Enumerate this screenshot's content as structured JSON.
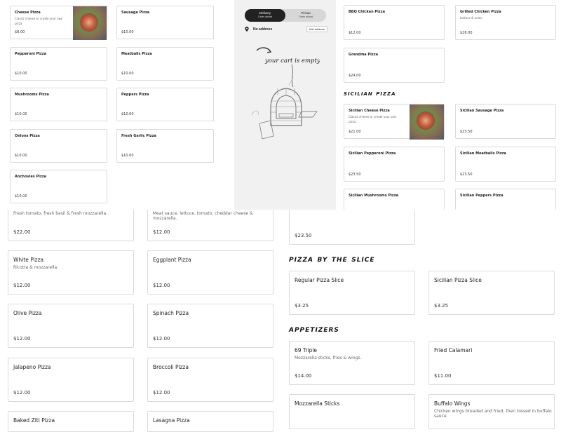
{
  "left_column_small": [
    {
      "name": "Cheese Pizza",
      "desc": "Classic cheese or create your own pizza.",
      "price": "$8.00",
      "thumb": true
    },
    {
      "name": "Pepperoni Pizza",
      "price": "$10.00"
    },
    {
      "name": "Mushrooms Pizza",
      "price": "$10.00"
    },
    {
      "name": "Onions Pizza",
      "price": "$10.00"
    },
    {
      "name": "Anchovies Pizza",
      "price": "$10.00"
    }
  ],
  "middle_column_small": [
    {
      "name": "Sausage Pizza",
      "price": "$10.00"
    },
    {
      "name": "Meatballs Pizza",
      "price": "$10.00"
    },
    {
      "name": "Peppers Pizza",
      "price": "$10.00"
    },
    {
      "name": "Fresh Garlic Pizza",
      "price": "$10.00"
    }
  ],
  "right_top": [
    {
      "name": "BBQ Chicken Pizza",
      "price": "$12.00"
    },
    {
      "name": "Grilled Chicken Pizza",
      "desc": "Lettuce & onion.",
      "price": "$26.00"
    },
    {
      "name": "Grandma Pizza",
      "price": "$24.00"
    }
  ],
  "sicilian_section_title": "sicilian pizza",
  "sicilian_items": [
    {
      "name": "Sicilian Cheese Pizza",
      "desc": "Classic cheese or create your own pizza.",
      "price": "$21.00",
      "thumb": true
    },
    {
      "name": "Sicilian Sausage Pizza",
      "price": "$23.50"
    },
    {
      "name": "Sicilian Pepperoni Pizza",
      "price": "$23.50"
    },
    {
      "name": "Sicilian Meatballs Pizza",
      "price": "$23.50"
    },
    {
      "name": "Sicilian Mushrooms Pizza",
      "price": ""
    },
    {
      "name": "Sicilian Peppers Pizza",
      "price": ""
    }
  ],
  "cart": {
    "delivery_label": "Delivery",
    "delivery_sub": "Order ahead",
    "pickup_label": "Pickup",
    "pickup_sub": "Order ahead",
    "address_label": "No address",
    "add_address_button": "Add address",
    "empty_text": "your cart is empty"
  },
  "bottom_left": [
    {
      "name": "",
      "desc": "Fresh tomato, fresh basil & fresh mozzarella.",
      "price": "$22.00"
    },
    {
      "name": "White Pizza",
      "desc": "Ricotta & mozzarella.",
      "price": "$12.00"
    },
    {
      "name": "Olive Pizza",
      "price": "$12.00"
    },
    {
      "name": "Jalapeno Pizza",
      "price": "$12.00"
    },
    {
      "name": "Baked Ziti Pizza",
      "price": ""
    }
  ],
  "bottom_middle": [
    {
      "name": "",
      "desc": "Meat sauce, lettuce, tomato, cheddar cheese & mozzarella.",
      "price": "$12.00"
    },
    {
      "name": "Eggplant Pizza",
      "price": "$12.00"
    },
    {
      "name": "Spinach Pizza",
      "price": "$12.00"
    },
    {
      "name": "Broccoli Pizza",
      "price": "$12.00"
    },
    {
      "name": "Lasagna Pizza",
      "price": ""
    }
  ],
  "bottom_right_top_price": "$23.50",
  "slice_section_title": "pizza by the slice",
  "slice_items": [
    {
      "name": "Regular Pizza Slice",
      "price": "$3.25"
    },
    {
      "name": "Sicilian Pizza Slice",
      "price": "$3.25"
    }
  ],
  "appetizers_section_title": "appetizers",
  "appetizer_items": [
    {
      "name": "69 Triple",
      "desc": "Mozzarella sticks, fries & wings.",
      "price": "$14.00"
    },
    {
      "name": "Fried Calamari",
      "price": "$11.00"
    },
    {
      "name": "Mozzarella Sticks",
      "price": ""
    },
    {
      "name": "Buffalo Wings",
      "desc": "Chicken wings breaded and fried, then tossed in buffalo sauce.",
      "price": ""
    }
  ]
}
